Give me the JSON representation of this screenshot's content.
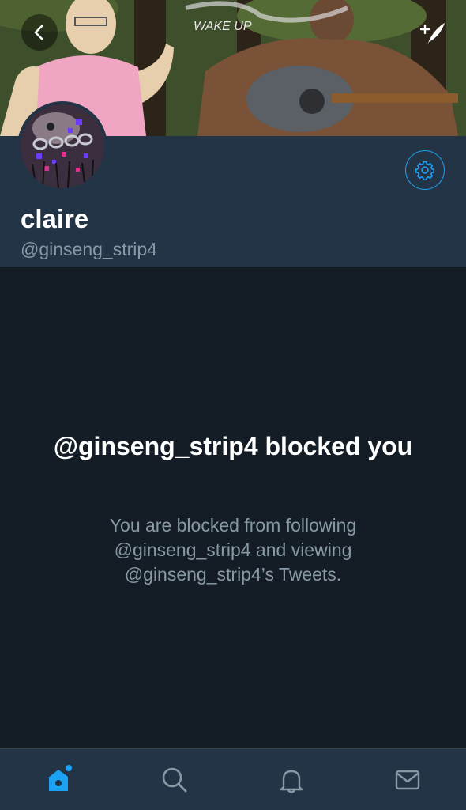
{
  "header": {
    "back_icon": "chevron-left-icon",
    "compose_icon": "compose-tweet-icon",
    "banner_text": "WAKE UP"
  },
  "profile": {
    "display_name": "claire",
    "handle": "@ginseng_strip4",
    "settings_icon": "gear-icon"
  },
  "blocked": {
    "title": "@ginseng_strip4 blocked you",
    "description": "You are blocked from following @ginseng_strip4 and viewing @ginseng_strip4’s Tweets."
  },
  "tabbar": {
    "tabs": [
      {
        "icon": "home-icon",
        "active": true
      },
      {
        "icon": "search-icon",
        "active": false
      },
      {
        "icon": "notifications-icon",
        "active": false
      },
      {
        "icon": "messages-icon",
        "active": false
      }
    ]
  },
  "colors": {
    "accent": "#1da1f2",
    "background": "#141d26",
    "surface": "#243447",
    "muted_text": "#8899a6"
  }
}
